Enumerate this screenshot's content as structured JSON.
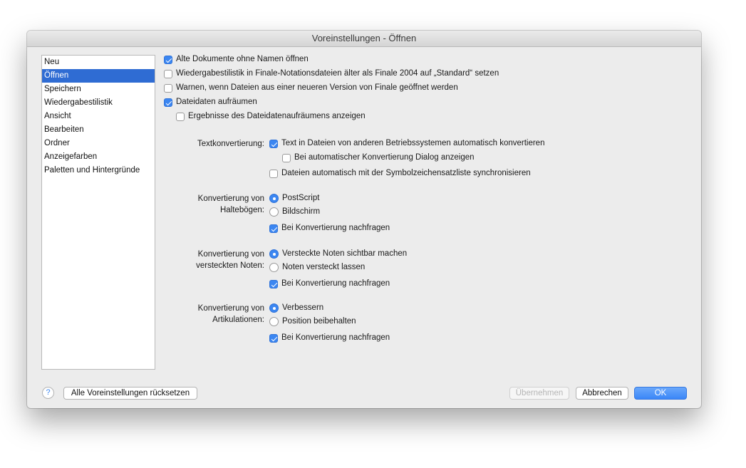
{
  "window": {
    "title": "Voreinstellungen - Öffnen"
  },
  "sidebar": {
    "items": [
      "Neu",
      "Öffnen",
      "Speichern",
      "Wiedergabestilistik",
      "Ansicht",
      "Bearbeiten",
      "Ordner",
      "Anzeigefarben",
      "Paletten und Hintergründe"
    ],
    "selected": "Öffnen"
  },
  "options": {
    "alte_dokumente": {
      "label": "Alte Dokumente ohne Namen öffnen",
      "checked": true
    },
    "wiedergabestilistik": {
      "label": "Wiedergabestilistik in Finale-Notationsdateien älter als Finale 2004 auf „Standard“ setzen",
      "checked": false
    },
    "warnen": {
      "label": "Warnen, wenn Dateien aus einer neueren Version von Finale geöffnet werden",
      "checked": false
    },
    "dateidaten": {
      "label": "Dateidaten aufräumen",
      "checked": true
    },
    "ergebnisse": {
      "label": "Ergebnisse des Dateidatenaufräumens anzeigen",
      "checked": false
    }
  },
  "text_conversion": {
    "label": "Textkonvertierung:",
    "auto_convert": {
      "label": "Text in Dateien von anderen Betriebssystemen automatisch konvertieren",
      "checked": true
    },
    "show_dialog": {
      "label": "Bei automatischer Konvertierung Dialog anzeigen",
      "checked": false
    },
    "sync_symbols": {
      "label": "Dateien automatisch mit der Symbolzeichensatzliste synchronisieren",
      "checked": false
    }
  },
  "ties_conversion": {
    "label_line1": "Konvertierung von",
    "label_line2": "Haltebögen:",
    "option1": "PostScript",
    "option2": "Bildschirm",
    "selected": "PostScript",
    "ask": {
      "label": "Bei Konvertierung nachfragen",
      "checked": true
    }
  },
  "hidden_notes_conversion": {
    "label_line1": "Konvertierung von",
    "label_line2": "versteckten Noten:",
    "option1": "Versteckte Noten sichtbar machen",
    "option2": "Noten versteckt lassen",
    "selected": "Versteckte Noten sichtbar machen",
    "ask": {
      "label": "Bei Konvertierung nachfragen",
      "checked": true
    }
  },
  "articulation_conversion": {
    "label_line1": "Konvertierung von",
    "label_line2": "Artikulationen:",
    "option1": "Verbessern",
    "option2": "Position beibehalten",
    "selected": "Verbessern",
    "ask": {
      "label": "Bei Konvertierung nachfragen",
      "checked": true
    }
  },
  "footer": {
    "help_label": "?",
    "reset_label": "Alle Voreinstellungen rücksetzen",
    "apply_label": "Übernehmen",
    "cancel_label": "Abbrechen",
    "ok_label": "OK"
  },
  "colors": {
    "accent": "#3b86f1",
    "selection": "#2f6cd3"
  }
}
